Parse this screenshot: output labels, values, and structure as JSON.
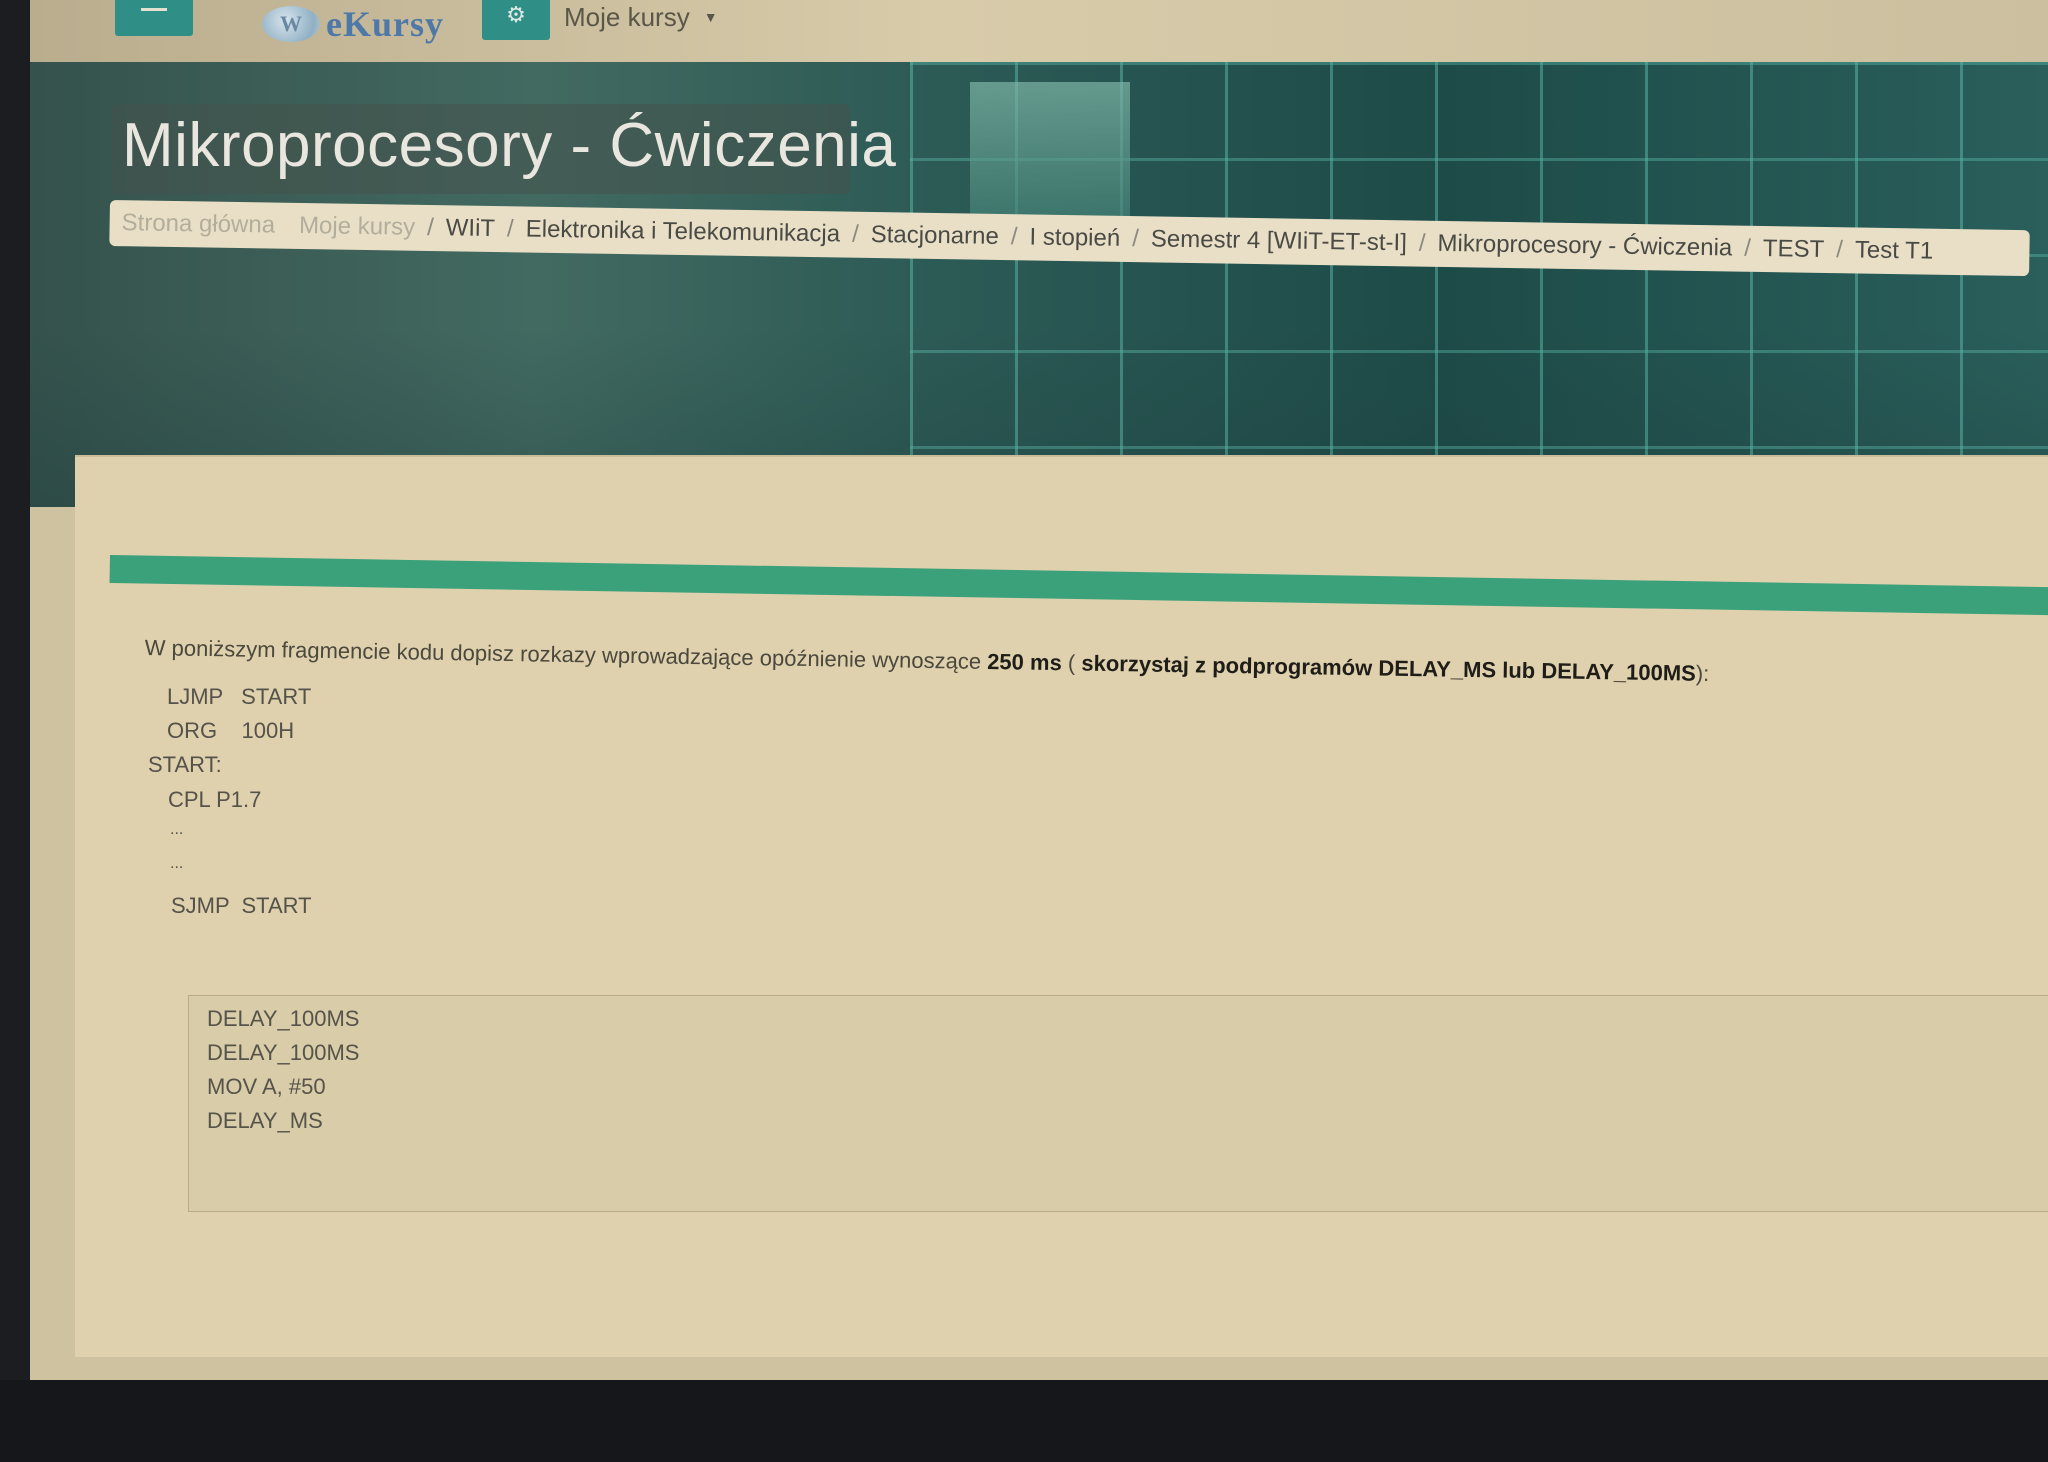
{
  "navbar": {
    "logo_text": "eKursy",
    "my_courses_label": "Moje kursy"
  },
  "header": {
    "course_title": "Mikroprocesory - Ćwiczenia",
    "breadcrumb": [
      "Strona główna",
      "Moje kursy",
      "WIiT",
      "Elektronika i Telekomunikacja",
      "Stacjonarne",
      "I stopień",
      "Semestr 4 [WIiT-ET-st-I]",
      "Mikroprocesory - Ćwiczenia",
      "TEST",
      "Test T1"
    ]
  },
  "question": {
    "prefix": "W poniższym fragmencie kodu dopisz rozkazy wprowadzające opóźnienie wynoszące ",
    "bold_value": "250 ms",
    "middle": " ( ",
    "bold_hint": "skorzystaj  z podprogramów DELAY_MS lub DELAY_100MS",
    "suffix": "):",
    "code": [
      "LJMP   START",
      "ORG    100H",
      "START:",
      "CPL P1.7",
      "...",
      "...",
      "SJMP  START"
    ]
  },
  "answer": {
    "lines": [
      "DELAY_100MS",
      "DELAY_100MS",
      "MOV A, #50",
      "DELAY_MS"
    ]
  },
  "colors": {
    "accent": "#2f8f86",
    "progress": "#3aa17b"
  }
}
